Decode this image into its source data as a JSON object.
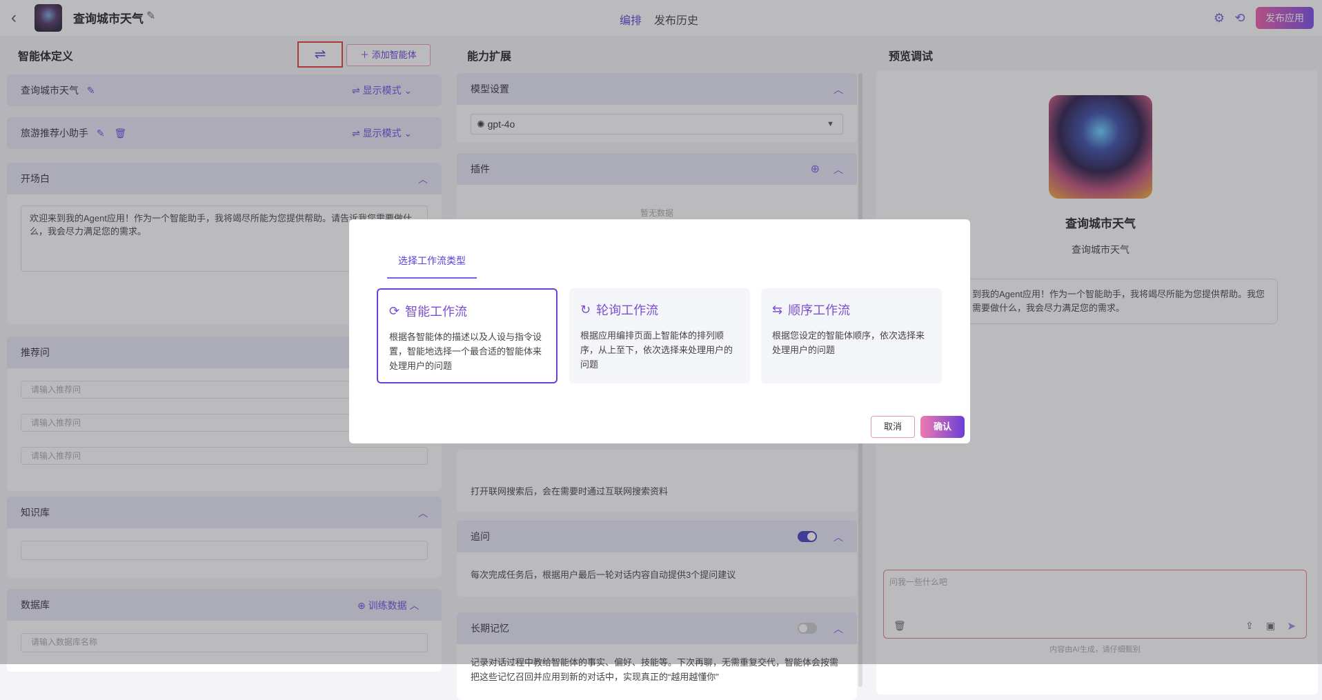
{
  "header": {
    "title": "查询城市天气",
    "tabs": [
      "编排",
      "发布历史"
    ],
    "publish_label": "发布应用"
  },
  "left": {
    "title": "智能体定义",
    "add_agent_label": "添加智能体",
    "agents": [
      {
        "name": "查询城市天气",
        "mode": "显示模式"
      },
      {
        "name": "旅游推荐小助手",
        "mode": "显示模式"
      }
    ],
    "opening": {
      "title": "开场白",
      "text": "欢迎来到我的Agent应用！作为一个智能助手，我将竭尽所能为您提供帮助。请告诉我您需要做什么，我会尽力满足您的需求。"
    },
    "suggest": {
      "title": "推荐问",
      "placeholders": [
        "请输入推荐问",
        "请输入推荐问",
        "请输入推荐问"
      ]
    },
    "knowledge": {
      "title": "知识库"
    },
    "database": {
      "title": "数据库",
      "train_label": "训练数据",
      "placeholder": "请输入数据库名称"
    }
  },
  "middle": {
    "title": "能力扩展",
    "model": {
      "title": "模型设置",
      "value": "gpt-4o"
    },
    "plugin": {
      "title": "插件",
      "empty": "暂无数据"
    },
    "web_search_desc": "打开联网搜索后，会在需要时通过互联网搜索资料",
    "followup": {
      "title": "追问",
      "desc": "每次完成任务后，根据用户最后一轮对话内容自动提供3个提问建议",
      "enabled": true
    },
    "memory": {
      "title": "长期记忆",
      "desc": "记录对话过程中教给智能体的事实、偏好、技能等。下次再聊，无需重复交代，智能体会按需把这些记忆召回并应用到新的对话中，实现真正的“越用越懂你”",
      "enabled": false
    }
  },
  "right": {
    "title": "预览调试",
    "bot_name": "查询城市天气",
    "bot_desc": "查询城市天气",
    "welcome": "到我的Agent应用！作为一个智能助手，我将竭尽所能为您提供帮助。我您需要做什么，我会尽力满足您的需求。",
    "input_placeholder": "问我一些什么吧",
    "footer": "内容由AI生成，请仔细甄别"
  },
  "modal": {
    "tab": "选择工作流类型",
    "cards": [
      {
        "title": "智能工作流",
        "desc": "根据各智能体的描述以及人设与指令设置，智能地选择一个最合适的智能体来处理用户的问题",
        "selected": true
      },
      {
        "title": "轮询工作流",
        "desc": "根据应用编排页面上智能体的排列顺序，从上至下，依次选择来处理用户的问题",
        "selected": false
      },
      {
        "title": "顺序工作流",
        "desc": "根据您设定的智能体顺序，依次选择来处理用户的问题",
        "selected": false
      }
    ],
    "cancel": "取消",
    "confirm": "确认"
  },
  "colors": {
    "accent": "#6a3fd6",
    "highlight_box": "#e53935"
  }
}
